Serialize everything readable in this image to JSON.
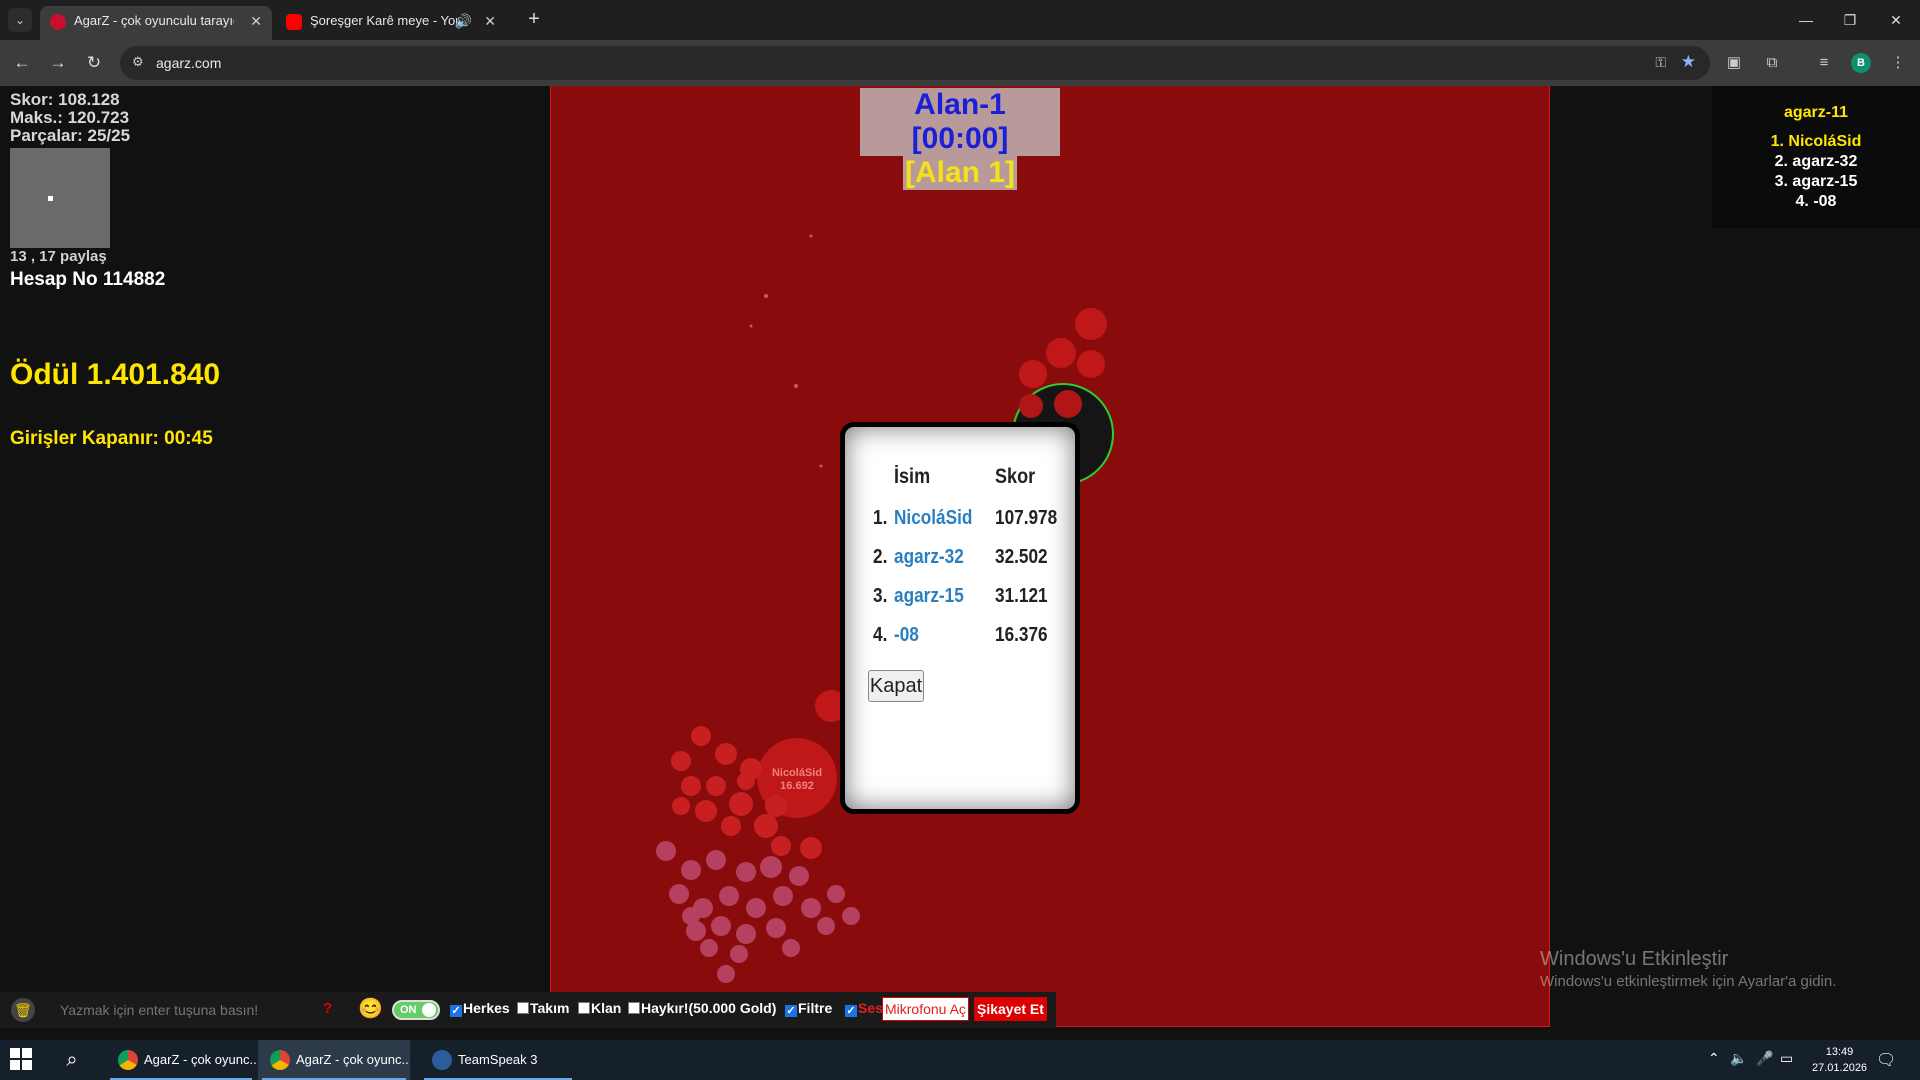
{
  "browser": {
    "tabs": [
      {
        "label": "AgarZ - çok oyunculu tarayıcı oyunu",
        "active": true
      },
      {
        "label": "Şoreşger Karê meye - YouTube",
        "active": false
      }
    ],
    "url": "agarz.com"
  },
  "hud": {
    "score": "Skor: 108.128",
    "max": "Maks.: 120.723",
    "pieces": "Parçalar: 25/25",
    "coords": "13 , 17 paylaş",
    "account": "Hesap No 114882",
    "prize": "Ödül 1.401.840",
    "entries": "Girişler Kapanır: 00:45"
  },
  "zone": {
    "title": "Alan-1 [00:00]",
    "subtitle": "[Alan 1]"
  },
  "leaderboard": {
    "title": "agarz-11",
    "items": [
      "1. NicoláSid",
      "2. agarz-32",
      "3. agarz-15",
      "4. -08"
    ]
  },
  "game": {
    "big_cell_name": "NicoláSid",
    "big_cell_mass": "16.692"
  },
  "modal": {
    "col_name": "İsim",
    "col_score": "Skor",
    "rows": [
      {
        "rank": "1.",
        "name": "NicoláSid",
        "score": "107.978"
      },
      {
        "rank": "2.",
        "name": "agarz-32",
        "score": "32.502"
      },
      {
        "rank": "3.",
        "name": "agarz-15",
        "score": "31.121"
      },
      {
        "rank": "4.",
        "name": "-08",
        "score": "16.376"
      }
    ],
    "close_label": "Kapat"
  },
  "bottom": {
    "chat_placeholder": "Yazmak için enter tuşuna basın!",
    "help": "?",
    "toggle": "ON",
    "everyone": "Herkes",
    "team": "Takım",
    "clan": "Klan",
    "shout": "Haykır!(50.000 Gold)",
    "filter": "Filtre",
    "sound": "Ses",
    "mic": "Mikrofonu Aç",
    "report": "Şikayet Et"
  },
  "watermark": {
    "line1": "Windows'u Etkinleştir",
    "line2": "Windows'u etkinleştirmek için Ayarlar'a gidin."
  },
  "taskbar": {
    "apps": [
      "AgarZ - çok oyunc...",
      "AgarZ - çok oyunc...",
      "TeamSpeak 3"
    ],
    "time": "13:49",
    "date": "27.01.2026"
  },
  "colors": {
    "arena": "#8a0b0b",
    "accent_yellow": "#ffe600",
    "name_blue": "#2a7fc0"
  }
}
